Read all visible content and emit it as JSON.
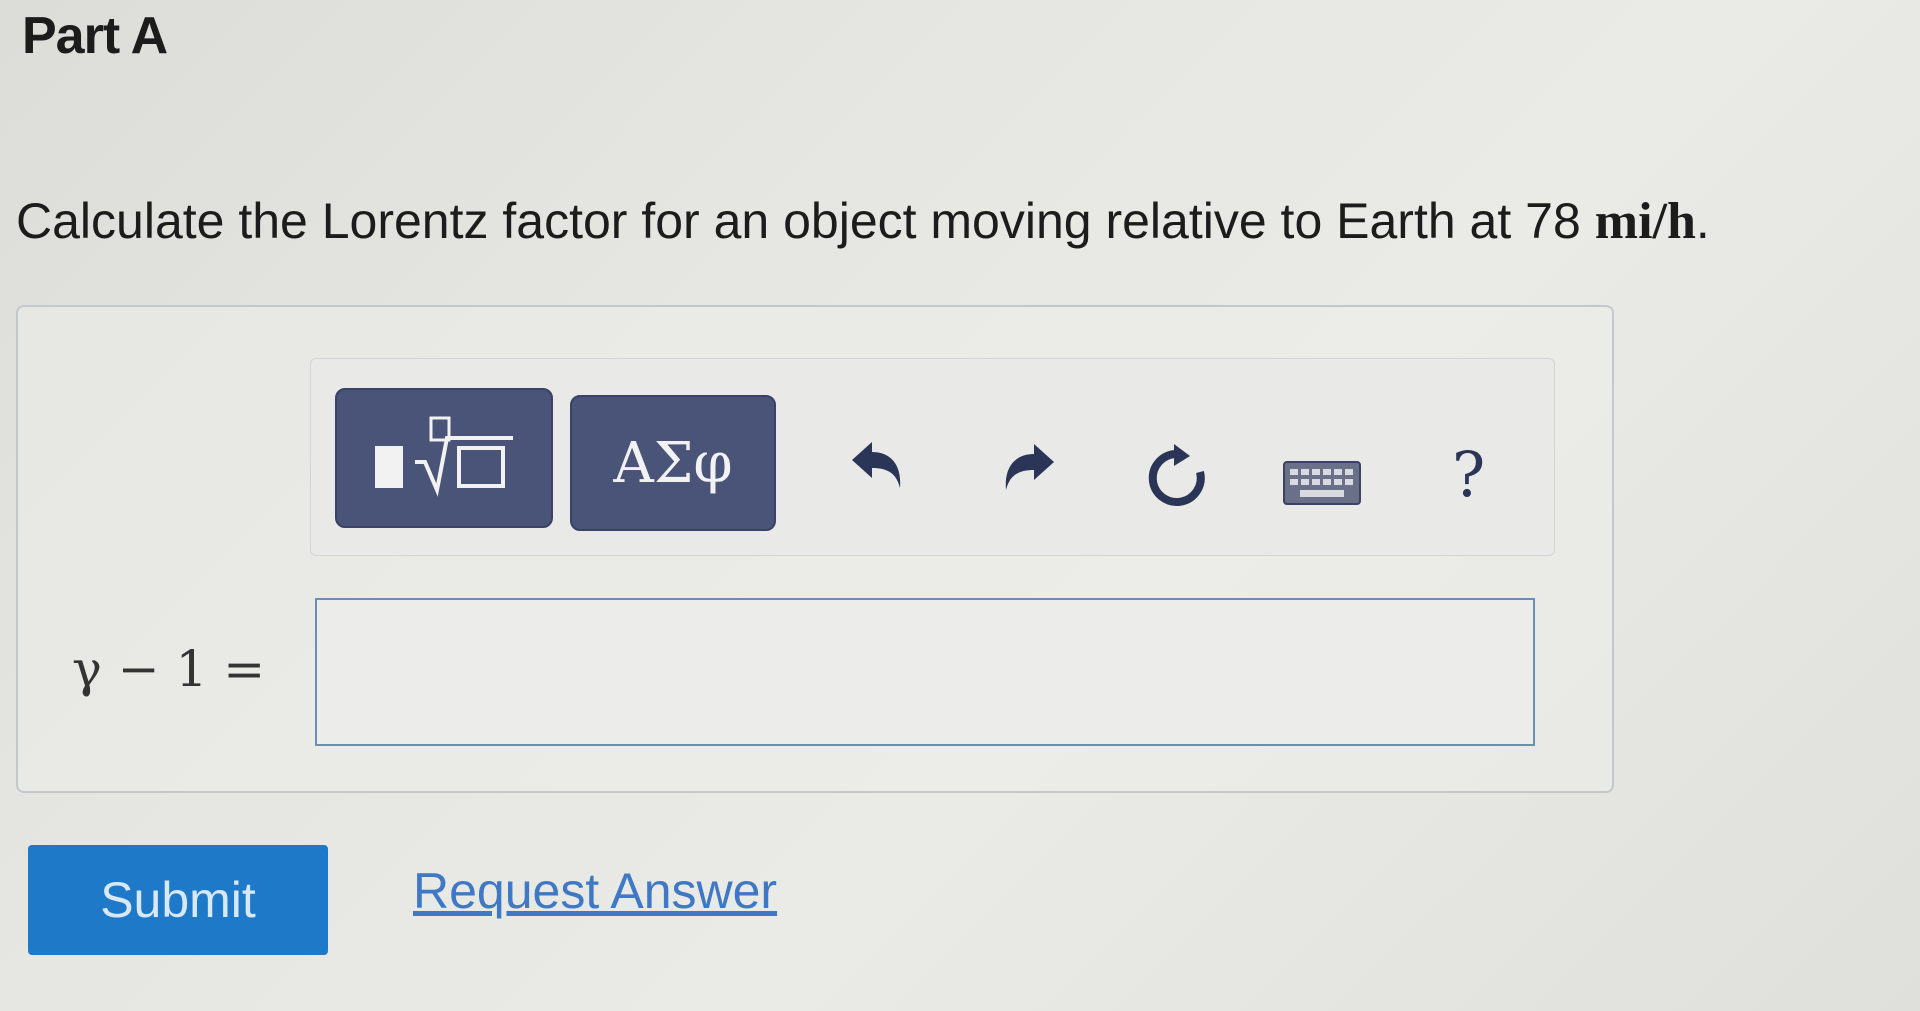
{
  "part": {
    "title": "Part A"
  },
  "question": {
    "text": "Calculate the Lorentz factor for an object moving relative to Earth at 78",
    "unit": "mi/h",
    "end": "."
  },
  "toolbar": {
    "symbols_label": "ΑΣφ",
    "help_label": "?"
  },
  "answer": {
    "label": "γ − 1 =",
    "value": ""
  },
  "actions": {
    "submit_label": "Submit",
    "request_answer_label": "Request Answer"
  },
  "icons": {
    "templates": "square-root-template-icon",
    "undo": "undo-icon",
    "redo": "redo-icon",
    "reset": "reset-icon",
    "keyboard": "keyboard-icon",
    "help": "help-icon"
  },
  "colors": {
    "toolbar_button": "#4a5378",
    "submit": "#1e7ac8",
    "link": "#3f78c4",
    "input_border": "#6a8fb5"
  }
}
